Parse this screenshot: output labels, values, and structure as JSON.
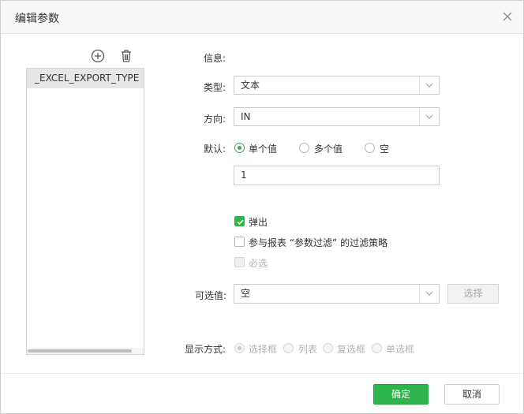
{
  "dialog": {
    "title": "编辑参数",
    "close_icon": "close-icon"
  },
  "param_list": {
    "add_icon": "plus-circle-icon",
    "delete_icon": "trash-icon",
    "items": [
      "_EXCEL_EXPORT_TYPE"
    ]
  },
  "form": {
    "info_label": "信息:",
    "type_label": "类型:",
    "type_value": "文本",
    "direction_label": "方向:",
    "direction_value": "IN",
    "default_label": "默认:",
    "default_options": [
      {
        "label": "单个值",
        "selected": true
      },
      {
        "label": "多个值",
        "selected": false
      },
      {
        "label": "空",
        "selected": false
      }
    ],
    "default_value": "1",
    "popup_label": "弹出",
    "popup_checked": true,
    "join_filter_label": "参与报表 “参数过滤” 的过滤策略",
    "join_filter_checked": false,
    "required_label": "必选",
    "required_disabled": true,
    "optional_label": "可选值:",
    "optional_value": "空",
    "select_button": "选择",
    "display_label": "显示方式:",
    "display_options": [
      {
        "label": "选择框",
        "selected": true
      },
      {
        "label": "列表",
        "selected": false
      },
      {
        "label": "复选框",
        "selected": false
      },
      {
        "label": "单选框",
        "selected": false
      }
    ]
  },
  "footer": {
    "ok": "确定",
    "cancel": "取消"
  },
  "colors": {
    "accent": "#2db44a",
    "border": "#cccccc",
    "header_bg": "#f8f8f8"
  }
}
